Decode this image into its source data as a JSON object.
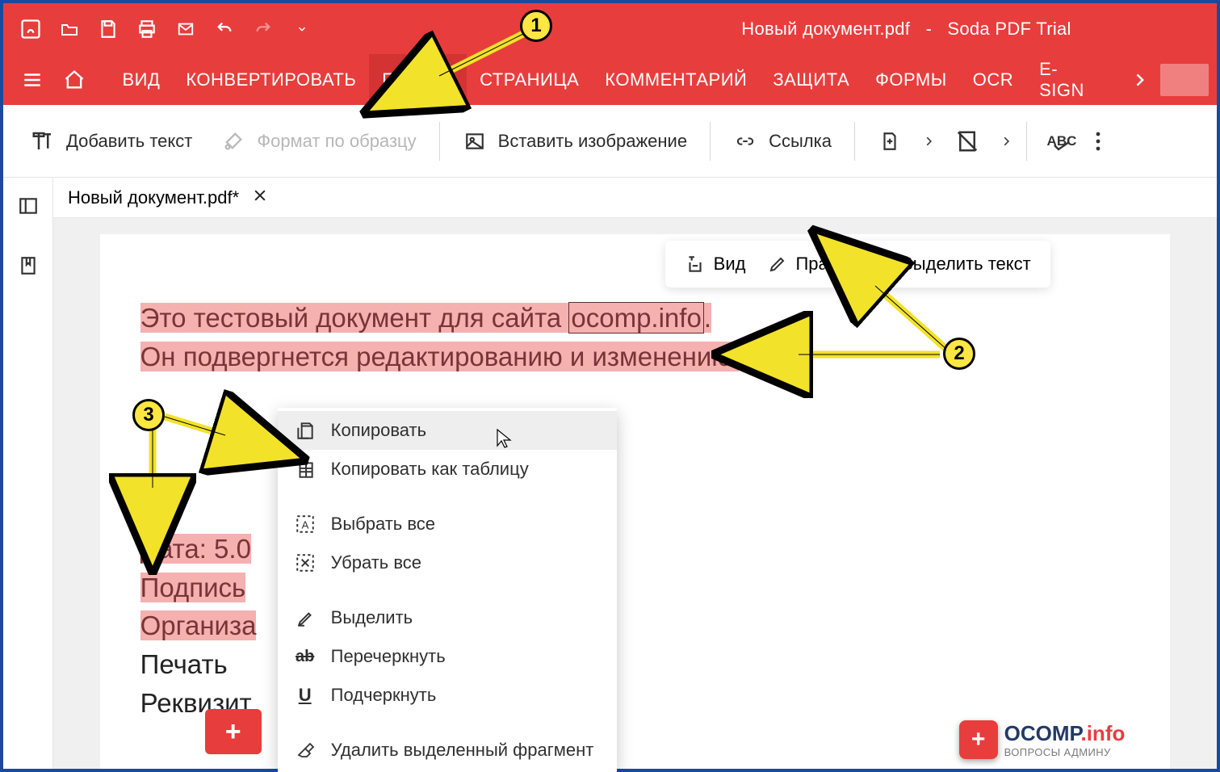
{
  "title": {
    "doc": "Новый документ.pdf",
    "sep": "-",
    "app": "Soda PDF Trial"
  },
  "ribbon": {
    "tabs": [
      "ВИД",
      "КОНВЕРТИРОВАТЬ",
      "ПРАВКА",
      "СТРАНИЦА",
      "КОММЕНТАРИЙ",
      "ЗАЩИТА",
      "ФОРМЫ",
      "OCR",
      "E-SIGN"
    ],
    "active_index": 2
  },
  "toolbar": {
    "add_text": "Добавить текст",
    "format_painter": "Формат по образцу",
    "insert_image": "Вставить изображение",
    "link": "Ссылка"
  },
  "doc_tab": {
    "label": "Новый документ.pdf*"
  },
  "mini": {
    "view": "Вид",
    "edit": "Правка",
    "select_text": "Выделить текст"
  },
  "page": {
    "line1a": "Это тестовый документ для сайта ",
    "line1_link": "ocomp.info",
    "line1b": ".",
    "line2": "Он подвергнется редактированию и изменению.",
    "date": "Дата: 5.0",
    "sign": "Подпись",
    "org": "Организа",
    "print": "Печать",
    "req": "Реквизит"
  },
  "context_menu": {
    "copy": "Копировать",
    "copy_table": "Копировать как таблицу",
    "select_all": "Выбрать все",
    "deselect_all": "Убрать все",
    "highlight": "Выделить",
    "strike": "Перечеркнуть",
    "underline": "Подчеркнуть",
    "delete_fragment": "Удалить выделенный фрагмент"
  },
  "callouts": {
    "1": "1",
    "2": "2",
    "3": "3"
  },
  "watermark": {
    "brand": "OCOMP",
    "tld": ".info",
    "sub": "ВОПРОСЫ АДМИНУ"
  }
}
